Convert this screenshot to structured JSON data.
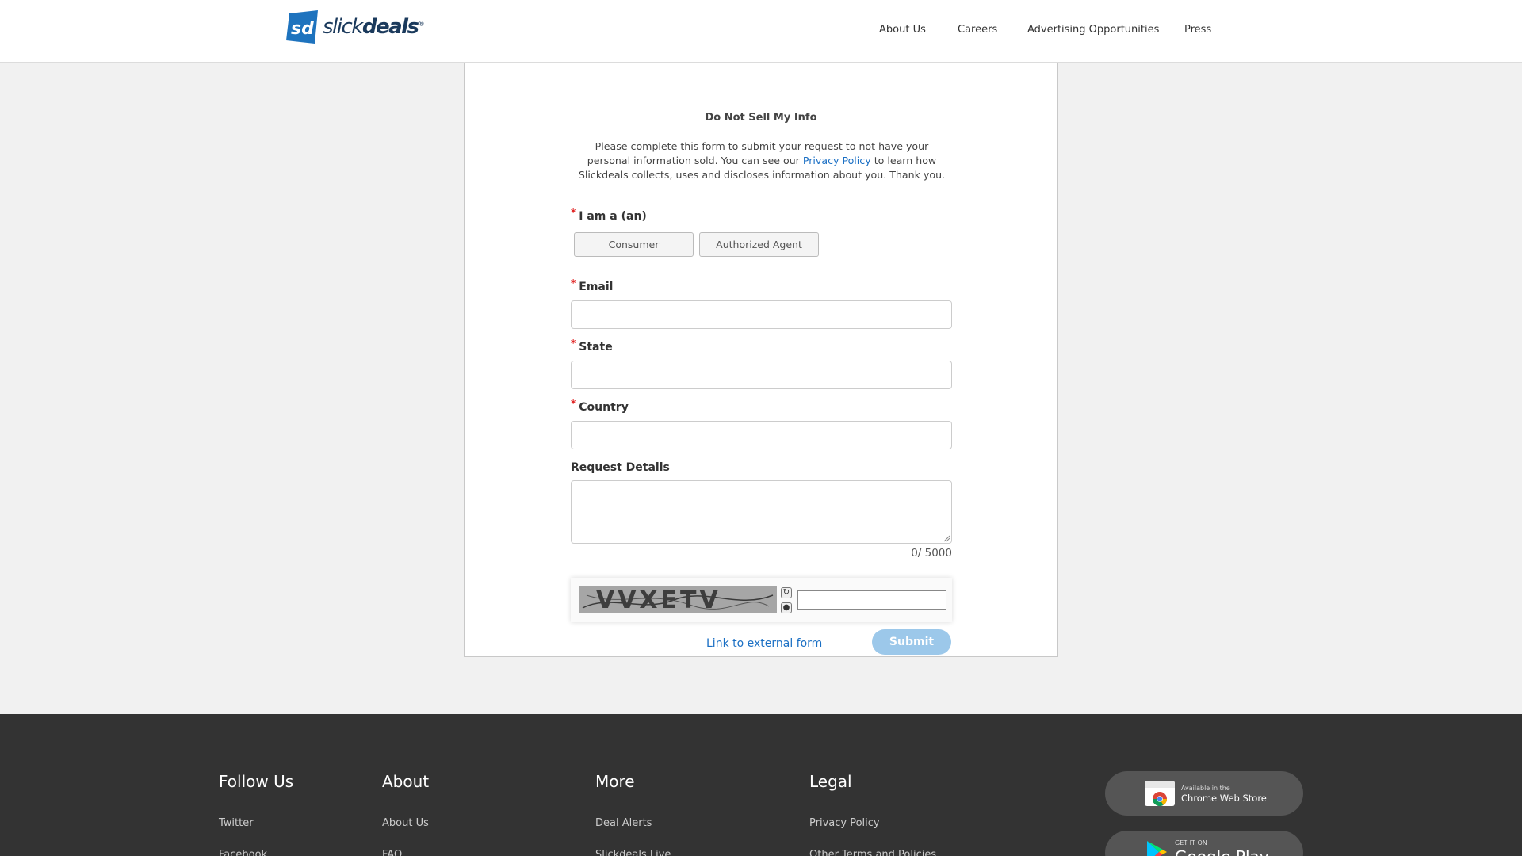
{
  "header": {
    "brand": {
      "thin": "slick",
      "bold": "deals",
      "reg": "®"
    },
    "nav": [
      "About Us",
      "Careers",
      "Advertising Opportunities",
      "Press"
    ]
  },
  "form": {
    "title": "Do Not Sell My Info",
    "intro_before": "Please complete this form to submit your request to not have your personal information sold. You can see our ",
    "intro_link": "Privacy Policy",
    "intro_after": " to learn how Slickdeals collects, uses and discloses information about you. Thank you.",
    "required_mark": "*",
    "iam_label": "I am a (an)",
    "choices": [
      "Consumer",
      "Authorized Agent"
    ],
    "email_label": "Email",
    "state_label": "State",
    "country_label": "Country",
    "details_label": "Request Details",
    "counter": "0/ 5000",
    "captcha_text": "VVXETV",
    "external_link": "Link to external form",
    "submit_label": "Submit"
  },
  "footer": {
    "columns": [
      {
        "title": "Follow Us",
        "links": [
          "Twitter",
          "Facebook"
        ]
      },
      {
        "title": "About",
        "links": [
          "About Us",
          "FAQ"
        ]
      },
      {
        "title": "More",
        "links": [
          "Deal Alerts",
          "Slickdeals Live"
        ]
      },
      {
        "title": "Legal",
        "links": [
          "Privacy Policy",
          "Other Terms and Policies"
        ]
      }
    ],
    "stores": {
      "chrome": {
        "small": "Available in the",
        "big": "Chrome Web Store"
      },
      "google": {
        "small": "GET IT ON",
        "big": "Google Play"
      }
    }
  },
  "colors": {
    "brand_navy": "#1b3a5c",
    "brand_blue": "#1e73be",
    "link_blue": "#1a6fc4",
    "required_red": "#e02020",
    "submit_bg": "#9cc8ea",
    "footer_bg": "#333333"
  }
}
